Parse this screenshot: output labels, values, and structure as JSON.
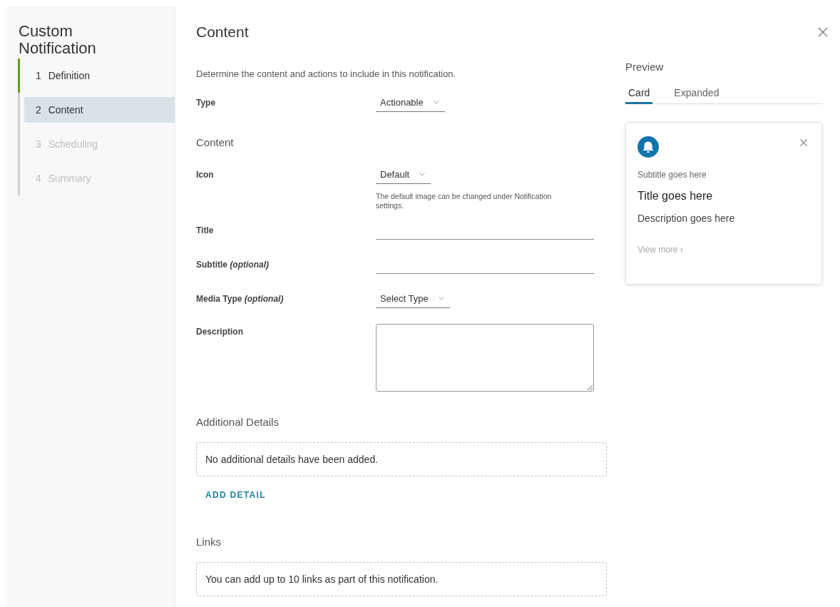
{
  "sidebar": {
    "title": "Custom Notification",
    "steps": [
      {
        "number": "1",
        "label": "Definition",
        "completed": true,
        "selected": false,
        "disabled": false
      },
      {
        "number": "2",
        "label": "Content",
        "completed": false,
        "selected": true,
        "disabled": false
      },
      {
        "number": "3",
        "label": "Scheduling",
        "completed": false,
        "selected": false,
        "disabled": true
      },
      {
        "number": "4",
        "label": "Summary",
        "completed": false,
        "selected": false,
        "disabled": true
      }
    ]
  },
  "main": {
    "title": "Content",
    "intro": "Determine the content and actions to include in this notification.",
    "fields": [
      {
        "kind": "select",
        "label": "Type",
        "value": "Actionable"
      },
      {
        "kind": "heading",
        "label": "Content"
      },
      {
        "kind": "select",
        "label": "Icon",
        "value": "Default",
        "help": "The default image can be changed under Notification settings."
      },
      {
        "kind": "input",
        "label": "Title"
      },
      {
        "kind": "input",
        "label": "Subtitle *(optional)*"
      },
      {
        "kind": "select",
        "label": "Media Type *(optional)*",
        "value": "Select Type"
      },
      {
        "kind": "textarea",
        "label": "Description"
      }
    ],
    "sections": [
      {
        "title": "Additional Details",
        "empty_text": "No additional details have been added.",
        "action": "ADD DETAIL"
      },
      {
        "title": "Links",
        "empty_text": "You can add up to 10 links as part of this notification."
      }
    ]
  },
  "preview": {
    "title": "Preview",
    "tabs": [
      {
        "label": "Card",
        "selected": true
      },
      {
        "label": "Expanded",
        "selected": false
      }
    ],
    "card": {
      "subtitle": "Subtitle goes here",
      "title": "Title goes here",
      "description": "Description goes here",
      "link": "View more ›"
    }
  }
}
